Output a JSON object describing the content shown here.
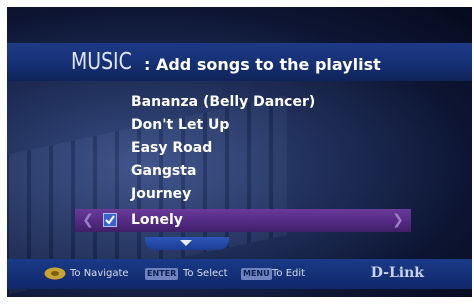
{
  "header": {
    "section": "MUSIC",
    "subtitle": ": Add songs to the playlist"
  },
  "songs": [
    {
      "title": "Bananza (Belly Dancer)",
      "selected": false
    },
    {
      "title": "Don't Let Up",
      "selected": false
    },
    {
      "title": "Easy Road",
      "selected": false
    },
    {
      "title": "Gangsta",
      "selected": false
    },
    {
      "title": "Journey",
      "selected": false
    },
    {
      "title": "Lonely",
      "selected": true,
      "checked": true
    }
  ],
  "footer": {
    "navigate_icon": "dpad-icon",
    "navigate_label": "To Navigate",
    "enter_key": "ENTER",
    "select_label": "To Select",
    "menu_key": "MENU",
    "edit_label": "To Edit",
    "brand": "D-Link"
  },
  "colors": {
    "band": "#163074",
    "highlight": "#512980",
    "text": "#ffffff"
  }
}
